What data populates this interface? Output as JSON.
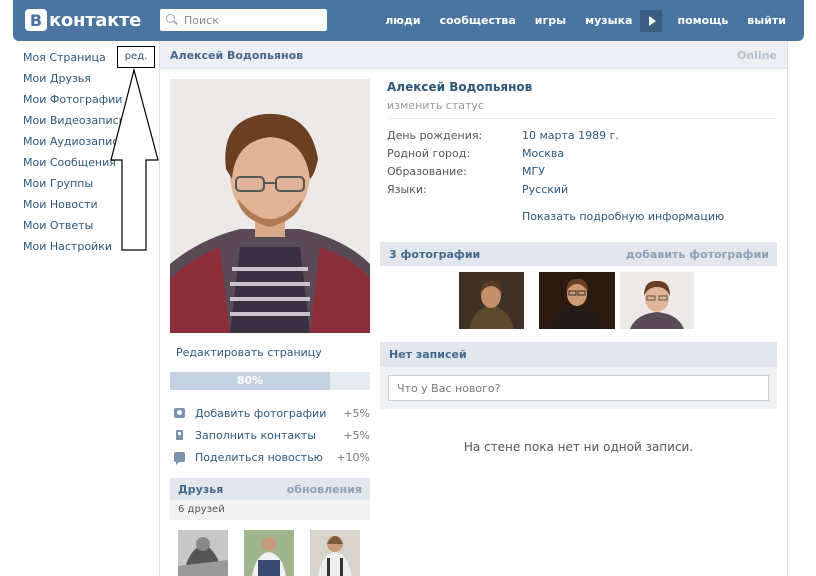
{
  "header": {
    "logo_letter": "В",
    "logo_text": "контакте",
    "search_placeholder": "Поиск",
    "nav": [
      "люди",
      "сообщества",
      "игры",
      "музыка",
      "помощь",
      "выйти"
    ]
  },
  "leftmenu": {
    "items": [
      "Моя Страница",
      "Мои Друзья",
      "Мои Фотографии",
      "Мои Видеозаписи",
      "Мои Аудиозаписи",
      "Мои Сообщения",
      "Мои Группы",
      "Мои Новости",
      "Мои Ответы",
      "Мои Настройки"
    ],
    "edit_label": "ред."
  },
  "profile": {
    "name": "Алексей Водопьянов",
    "online": "Online",
    "status_link": "изменить статус",
    "edit_page": "Редактировать страницу",
    "progress_label": "80%",
    "progress_value": 0.8,
    "todos": [
      {
        "icon": "camera-icon",
        "label": "Добавить фотографии",
        "pct": "+5%"
      },
      {
        "icon": "phone-icon",
        "label": "Заполнить контакты",
        "pct": "+5%"
      },
      {
        "icon": "speech-bubble-icon",
        "label": "Поделиться новостью",
        "pct": "+10%"
      }
    ],
    "info": [
      {
        "key": "День рождения:",
        "value": "10 марта 1989 г."
      },
      {
        "key": "Родной город:",
        "value": "Москва"
      },
      {
        "key": "Образование:",
        "value": "МГУ"
      },
      {
        "key": "Языки:",
        "value": "Русский"
      }
    ],
    "more_info": "Показать подробную информацию"
  },
  "photos": {
    "title": "3 фотографии",
    "add": "добавить фотографии"
  },
  "friends": {
    "title": "Друзья",
    "updates": "обновления",
    "count": "6 друзей"
  },
  "wall": {
    "title": "Нет записей",
    "placeholder": "Что у Вас нового?",
    "empty": "На стене пока нет ни одной записи."
  }
}
